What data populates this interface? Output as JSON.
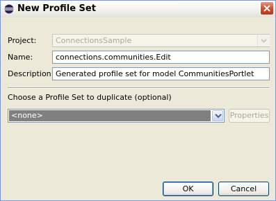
{
  "window": {
    "title": "New Profile Set",
    "accent_color": "#7a96df"
  },
  "form": {
    "project_label": "Project:",
    "project_value": "ConnectionsSample",
    "name_label": "Name:",
    "name_value": "connections.communities.Edit",
    "description_label": "Description:",
    "description_value": "Generated profile set for model CommunitiesPortlet"
  },
  "duplicate": {
    "label": "Choose a Profile Set to duplicate (optional)",
    "selected": "<none>",
    "properties_label": "Properties"
  },
  "buttons": {
    "ok_label": "OK",
    "cancel_label": "Cancel"
  },
  "icons": {
    "title": "eclipse-icon",
    "close": "close-icon",
    "dropdown": "chevron-down-icon"
  }
}
